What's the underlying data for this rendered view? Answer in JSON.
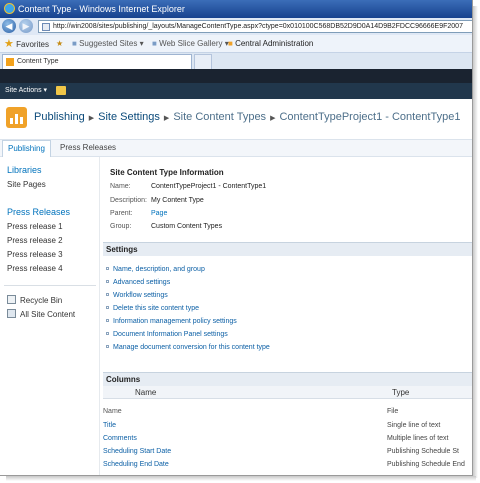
{
  "window": {
    "title": "Content Type - Windows Internet Explorer"
  },
  "browser": {
    "address": "http://win2008/sites/publishing/_layouts/ManageContentType.aspx?ctype=0x010100C568DB52D9D0A14D9B2FDCC96666E9F2007",
    "favorites_label": "Favorites",
    "suggested_sites": "Suggested Sites",
    "web_slice_gallery": "Web Slice Gallery",
    "central_admin": "Central Administration",
    "tab_label": "Content Type"
  },
  "ribbon": {
    "site_actions": "Site Actions"
  },
  "breadcrumb": [
    "Publishing",
    "Site Settings",
    "Site Content Types",
    "ContentTypeProject1 - ContentType1"
  ],
  "top_nav": [
    "Publishing",
    "Press Releases"
  ],
  "left_nav": {
    "libraries_heading": "Libraries",
    "libraries": [
      "Site Pages"
    ],
    "press_heading": "Press Releases",
    "press_items": [
      "Press release 1",
      "Press release 2",
      "Press release 3",
      "Press release 4"
    ],
    "recycle_bin": "Recycle Bin",
    "all_site_content": "All Site Content"
  },
  "info": {
    "title": "Site Content Type Information",
    "rows": [
      {
        "key": "Name:",
        "value": "ContentTypeProject1 - ContentType1"
      },
      {
        "key": "Description:",
        "value": "My Content Type"
      },
      {
        "key": "Parent:",
        "value": "Page"
      },
      {
        "key": "Group:",
        "value": "Custom Content Types"
      }
    ]
  },
  "settings": {
    "heading": "Settings",
    "items": [
      "Name, description, and group",
      "Advanced settings",
      "Workflow settings",
      "Delete this site content type",
      "Information management policy settings",
      "Document Information Panel settings",
      "Manage document conversion for this content type"
    ]
  },
  "columns": {
    "heading": "Columns",
    "name_header": "Name",
    "type_header": "Type",
    "rows": [
      {
        "name": "Name",
        "type": "File"
      },
      {
        "name": "Title",
        "type": "Single line of text"
      },
      {
        "name": "Comments",
        "type": "Multiple lines of text"
      },
      {
        "name": "Scheduling Start Date",
        "type": "Publishing Schedule St"
      },
      {
        "name": "Scheduling End Date",
        "type": "Publishing Schedule End"
      }
    ]
  }
}
